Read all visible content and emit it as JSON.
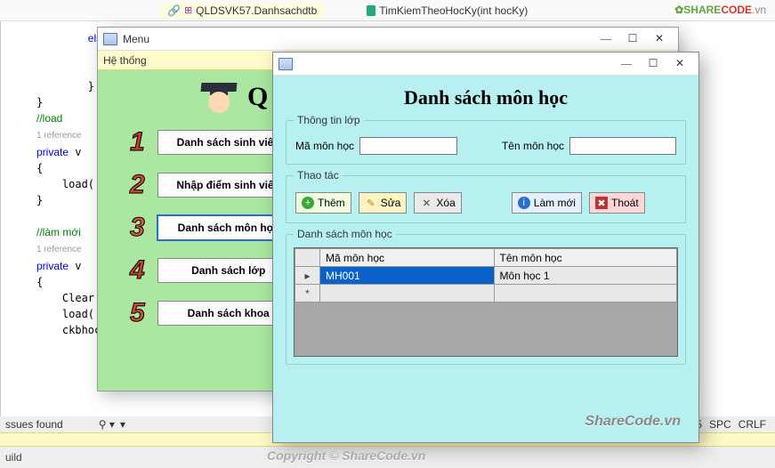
{
  "ide": {
    "tab1": "QLDSVK57.Danhsachdtb",
    "tab2": "TimKiemTheoHocKy(int hocKy)",
    "code": "\n        else\n            M\n            r\n        }\n}\n//load\n1 reference\nprivate v\n{\n    load(\n}\n\n//làm mới\n1 reference\nprivate v\n{\n    Clear\n    load(\n    ckbhocki.Checked = false;",
    "issues": "ssues found",
    "chcol": "Ch: 55",
    "spc": "SPC",
    "crlf": "CRLF",
    "build": "uild"
  },
  "logo": {
    "a": "SHARE",
    "b": "CODE",
    "c": ".vn"
  },
  "menuWin": {
    "title": "Menu",
    "hethong": "Hệ thống",
    "Q": "Q",
    "buttons": [
      "Danh sách sinh viên",
      "Nhập điểm  sinh viên",
      "Danh sách môn học",
      "Danh sách lớp",
      "Danh sách khoa"
    ]
  },
  "dlg": {
    "heading": "Danh sách môn học",
    "gbInfo": "Thông tin lớp",
    "lblCode": "Mã môn học",
    "lblName": "Tên môn học",
    "valCode": "",
    "valName": "",
    "gbActions": "Thao tác",
    "btnAdd": "Thêm",
    "btnEdit": "Sửa",
    "btnDel": "Xóa",
    "btnRefresh": "Làm mới",
    "btnExit": "Thoát",
    "gbList": "Danh sách môn học",
    "colCode": "Mã môn học",
    "colName": "Tên môn học",
    "rows": [
      {
        "code": "MH001",
        "name": "Môn học 1"
      }
    ]
  },
  "watermark1": "ShareCode.vn",
  "watermark2": "Copyright © ShareCode.vn"
}
